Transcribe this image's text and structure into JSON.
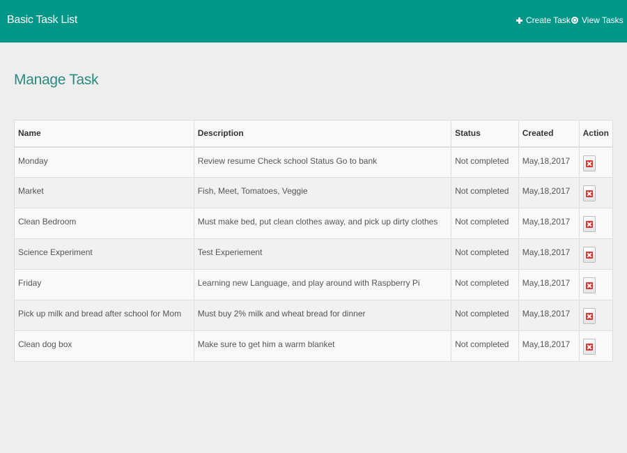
{
  "navbar": {
    "brand": "Basic Task List",
    "links": [
      {
        "label": "Create Task",
        "icon": "plus-icon"
      },
      {
        "label": "View Tasks",
        "icon": "eye-icon"
      }
    ],
    "color": "#009688"
  },
  "page": {
    "title": "Manage Task",
    "title_color": "#2a8a7e"
  },
  "table": {
    "headers": [
      "Name",
      "Description",
      "Status",
      "Created",
      "Action"
    ],
    "rows": [
      {
        "name": "Monday",
        "description": "Review resume Check school Status Go to bank",
        "status": "Not completed",
        "created": "May,18,2017",
        "action_icon": "delete-icon"
      },
      {
        "name": "Market",
        "description": "Fish, Meet, Tomatoes, Veggie",
        "status": "Not completed",
        "created": "May,18,2017",
        "action_icon": "delete-icon"
      },
      {
        "name": "Clean Bedroom",
        "description": "Must make bed, put clean clothes away, and pick up dirty clothes",
        "status": "Not completed",
        "created": "May,18,2017",
        "action_icon": "delete-icon"
      },
      {
        "name": "Science Experiment",
        "description": "Test Experiement",
        "status": "Not completed",
        "created": "May,18,2017",
        "action_icon": "delete-icon"
      },
      {
        "name": "Friday",
        "description": "Learning new Language, and play around with Raspberry Pi",
        "status": "Not completed",
        "created": "May,18,2017",
        "action_icon": "delete-icon"
      },
      {
        "name": "Pick up milk and bread after school for Mom",
        "description": "Must buy 2% milk and wheat bread for dinner",
        "status": "Not completed",
        "created": "May,18,2017",
        "action_icon": "delete-icon"
      },
      {
        "name": "Clean dog box",
        "description": "Make sure to get him a warm blanket",
        "status": "Not completed",
        "created": "May,18,2017",
        "action_icon": "delete-icon"
      }
    ]
  }
}
